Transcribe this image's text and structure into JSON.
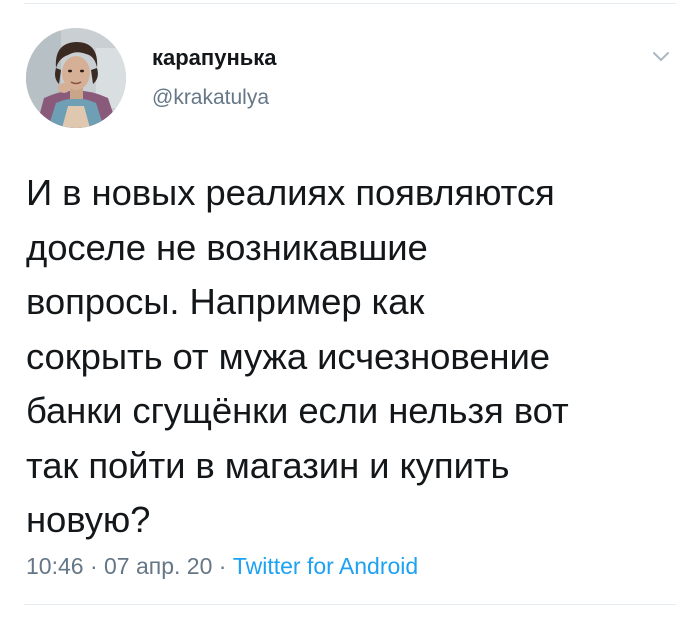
{
  "tweet": {
    "display_name": "карапунька",
    "handle": "@krakatulya",
    "text": "И в новых реалиях появляются\nдоселе не возникавшие\nвопросы. Например как\nсокрыть от мужа исчезновение\nбанки сгущёнки если нельзя вот\nтак пойти в магазин и купить\nновую?",
    "time": "10:46",
    "date": "07 апр. 20",
    "separator": " · ",
    "source": "Twitter for Android"
  },
  "icons": {
    "menu": "chevron-down-icon",
    "avatar": "profile-photo"
  },
  "colors": {
    "text": "#14171a",
    "secondary": "#657786",
    "link": "#1da1f2",
    "divider": "#e6ecf0"
  }
}
